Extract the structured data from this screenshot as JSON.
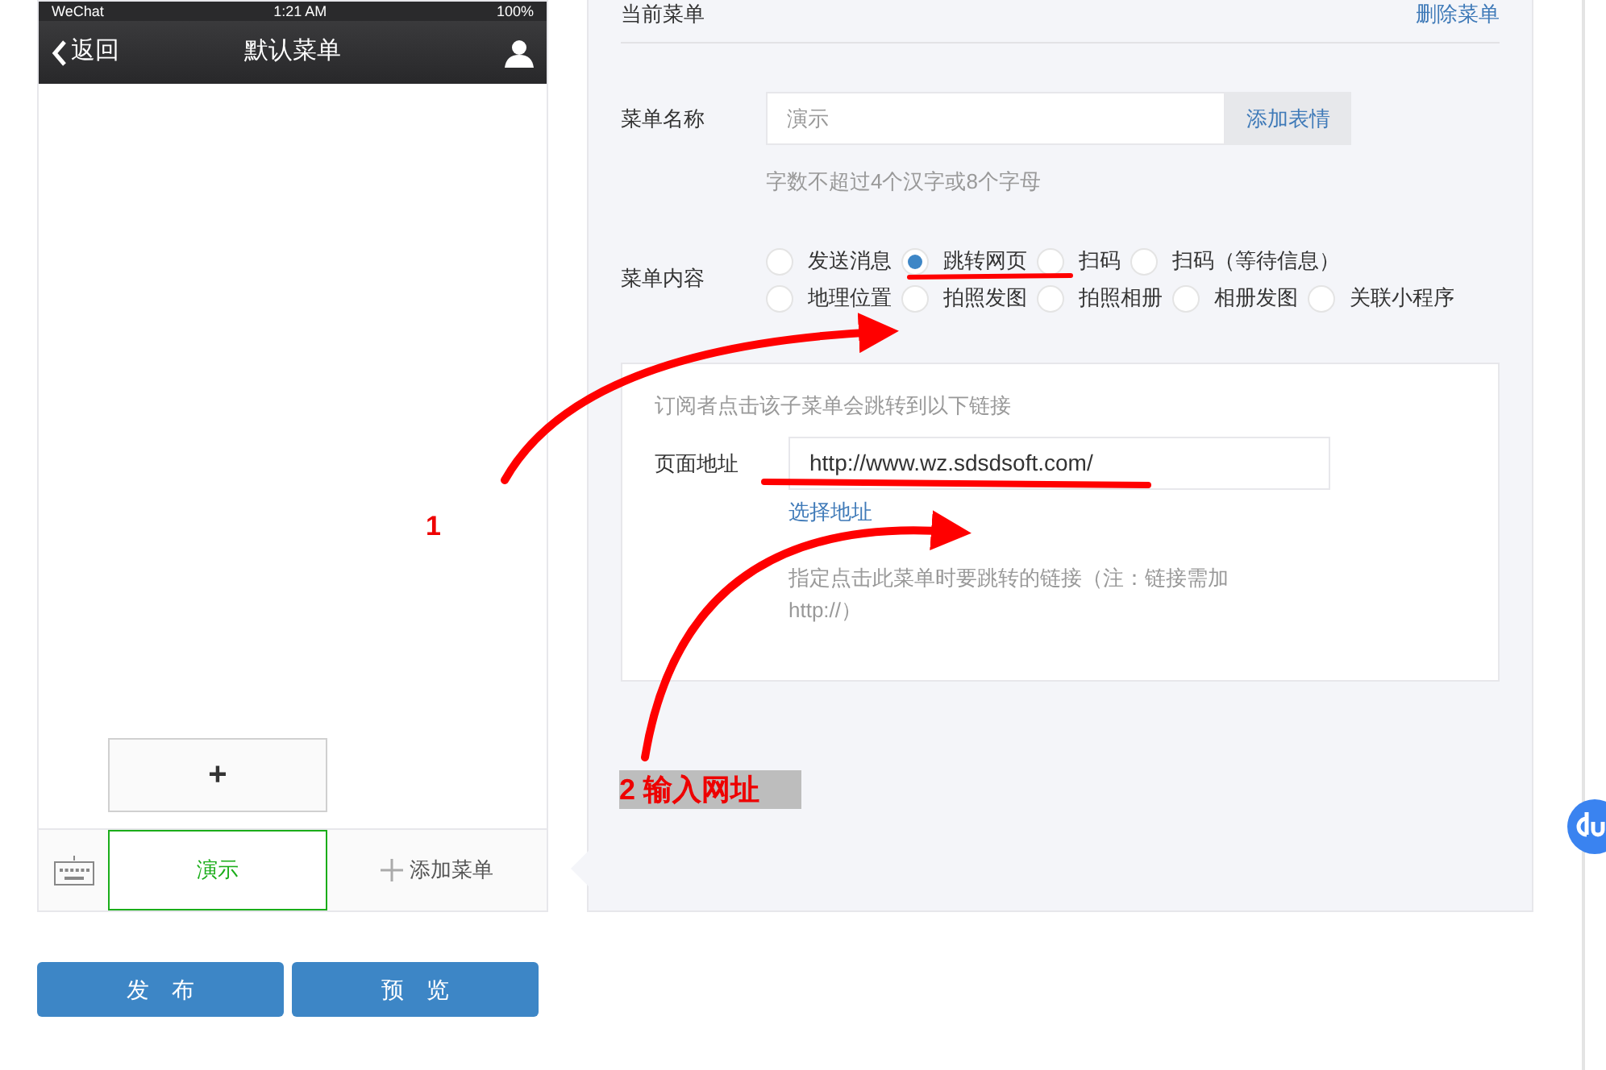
{
  "phone": {
    "status_bar": {
      "carrier": "WeChat",
      "time": "1:21 AM",
      "battery": "100%"
    },
    "nav": {
      "back": "返回",
      "title": "默认菜单"
    },
    "sub_menu_add": "+",
    "menu_items": [
      {
        "kind": "menu",
        "label": "演示",
        "selected": true
      },
      {
        "kind": "add",
        "label": "添加菜单",
        "selected": false
      }
    ]
  },
  "buttons": [
    "发　布",
    "预　览"
  ],
  "editor": {
    "header": "当前菜单",
    "delete": "删除菜单",
    "name_label": "菜单名称",
    "name_value": "演示",
    "emoji_button": "添加表情",
    "name_hint": "字数不超过4个汉字或8个字母",
    "content_label": "菜单内容",
    "options": [
      {
        "label": "发送消息",
        "selected": false
      },
      {
        "label": "跳转网页",
        "selected": true
      },
      {
        "label": "扫码",
        "selected": false
      },
      {
        "label": "扫码（等待信息）",
        "selected": false
      },
      {
        "label": "地理位置",
        "selected": false
      },
      {
        "label": "拍照发图",
        "selected": false
      },
      {
        "label": "拍照相册",
        "selected": false
      },
      {
        "label": "相册发图",
        "selected": false
      },
      {
        "label": "关联小程序",
        "selected": false
      }
    ],
    "link_box": {
      "intro": "订阅者点击该子菜单会跳转到以下链接",
      "url_label": "页面地址",
      "url_value": "http://www.wz.sdsdsoft.com/",
      "choose": "选择地址",
      "hint": "指定点击此菜单时要跳转的链接（注：链接需加http://）"
    }
  },
  "annotations": [
    {
      "text": "1"
    },
    {
      "text": "2 输入网址"
    }
  ]
}
